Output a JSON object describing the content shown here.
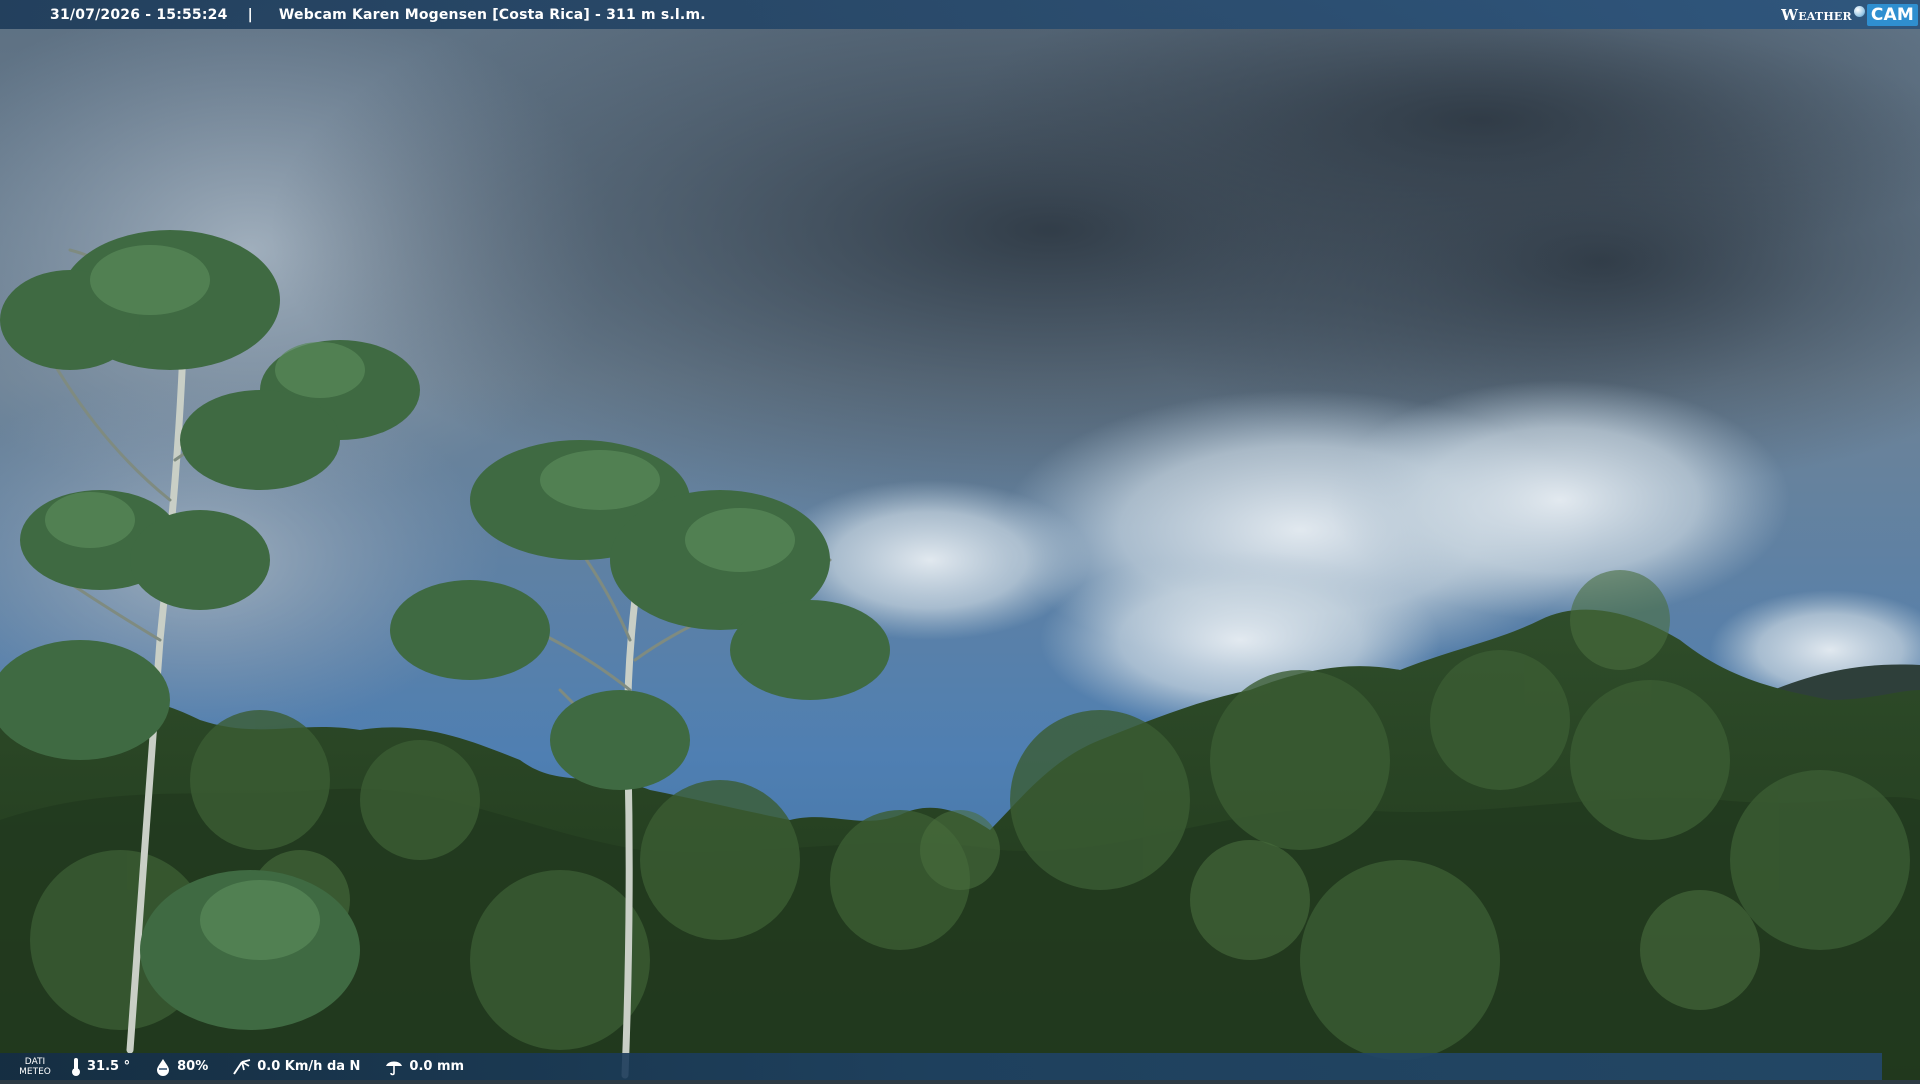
{
  "topbar": {
    "timestamp": "31/07/2026 - 15:55:24",
    "separator": "|",
    "title": "Webcam Karen Mogensen [Costa Rica] - 311 m s.l.m."
  },
  "logo": {
    "weather_text": "Weather",
    "cam_text": "CAM",
    "accent": "#2f8fd0"
  },
  "weather_data": {
    "label_line1": "DATI",
    "label_line2": "METEO",
    "temperature": {
      "icon": "thermometer-icon",
      "value": "31.5 °"
    },
    "humidity": {
      "icon": "humidity-drop-icon",
      "value": "80%"
    },
    "wind": {
      "icon": "wind-icon",
      "value": "0.0 Km/h da N"
    },
    "rain": {
      "icon": "rain-icon",
      "value": "0.0 mm"
    }
  }
}
